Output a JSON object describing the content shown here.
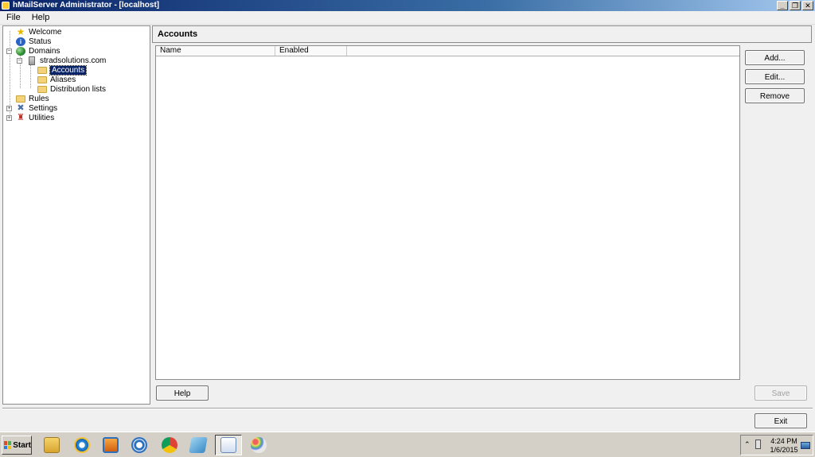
{
  "window": {
    "title": "hMailServer Administrator - [localhost]"
  },
  "menu": [
    "File",
    "Help"
  ],
  "tree": {
    "welcome": "Welcome",
    "status": "Status",
    "domains": "Domains",
    "domain": "stradsolutions.com",
    "accounts": "Accounts",
    "aliases": "Aliases",
    "distribution_lists": "Distribution lists",
    "rules": "Rules",
    "settings": "Settings",
    "utilities": "Utilities"
  },
  "panel": {
    "title": "Accounts"
  },
  "list": {
    "columns": [
      "Name",
      "Enabled"
    ]
  },
  "buttons": {
    "add": "Add...",
    "edit": "Edit...",
    "remove": "Remove",
    "help": "Help",
    "save": "Save",
    "exit": "Exit"
  },
  "taskbar": {
    "start": "Start",
    "apps": [
      "file-explorer-icon",
      "internet-explorer-icon",
      "media-player-icon",
      "network-icon",
      "chrome-icon",
      "app-icon",
      "hmailserver-icon",
      "paint-icon"
    ],
    "time": "4:24 PM",
    "date": "1/6/2015"
  }
}
